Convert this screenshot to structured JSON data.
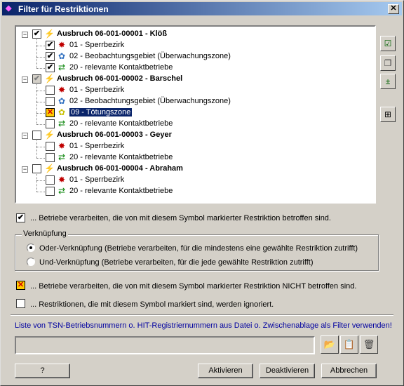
{
  "window": {
    "title": "Filter für Restriktionen",
    "close_label": "✕"
  },
  "tree": {
    "outbreaks": [
      {
        "label": "Ausbruch 06-001-00001 - Klöß",
        "checked": "✔",
        "children": [
          {
            "label": "01 - Sperrbezirk",
            "checked": "✔",
            "icon": "red-star-icon"
          },
          {
            "label": "02 - Beobachtungsgebiet (Überwachungszone)",
            "checked": "✔",
            "icon": "blue-flower-icon"
          },
          {
            "label": "20 - relevante Kontaktbetriebe",
            "checked": "✔",
            "icon": "contact-arrows-icon"
          }
        ]
      },
      {
        "label": "Ausbruch 06-001-00002 - Barschel",
        "checked": "✔",
        "children": [
          {
            "label": "01 - Sperrbezirk",
            "checked": "",
            "icon": "red-star-icon"
          },
          {
            "label": "02 - Beobachtungsgebiet (Überwachungszone)",
            "checked": "",
            "icon": "blue-flower-icon"
          },
          {
            "label": "09 - Tötungszone",
            "checked": "✕",
            "icon": "yellow-flower-icon",
            "selected": true
          },
          {
            "label": "20 - relevante Kontaktbetriebe",
            "checked": "",
            "icon": "contact-arrows-icon"
          }
        ]
      },
      {
        "label": "Ausbruch 06-001-00003 - Geyer",
        "checked": "",
        "children": [
          {
            "label": "01 - Sperrbezirk",
            "checked": "",
            "icon": "red-star-icon"
          },
          {
            "label": "20 - relevante Kontaktbetriebe",
            "checked": "",
            "icon": "contact-arrows-icon"
          }
        ]
      },
      {
        "label": "Ausbruch 06-001-00004 - Abraham",
        "checked": "",
        "children": [
          {
            "label": "01 - Sperrbezirk",
            "checked": "",
            "icon": "red-star-icon"
          },
          {
            "label": "20 - relevante Kontaktbetriebe",
            "checked": "",
            "icon": "contact-arrows-icon"
          }
        ]
      }
    ]
  },
  "legend": {
    "checked_text": "... Betriebe verarbeiten, die von mit diesem Symbol markierter Restriktion betroffen sind.",
    "checked_symbol": "✔",
    "group_title": "Verknüpfung",
    "or_option": "Oder-Verknüpfung (Betriebe verarbeiten, für die mindestens eine gewählte Restriktion zutrifft)",
    "and_option": "Und-Verknüpfung (Betriebe verarbeiten, für die jede gewählte Restriktion zutrifft)",
    "excluded_symbol": "✕",
    "excluded_text": "... Betriebe verarbeiten, die von mit diesem Symbol markierter Restriktion NICHT betroffen sind.",
    "ignored_text": "... Restriktionen, die mit diesem Symbol markiert sind, werden ignoriert."
  },
  "filter_file": {
    "link_text": "Liste von TSN-Betriebsnummern o. HIT-Registriernummern aus Datei o. Zwischenablage als Filter verwenden!",
    "value": ""
  },
  "buttons": {
    "help": "?",
    "activate": "Aktivieren",
    "deactivate": "Deaktivieren",
    "cancel": "Abbrechen"
  },
  "side_icons": [
    "check-all-icon",
    "copy-icon",
    "toggle-icon",
    "tree-icon"
  ],
  "colors": {
    "title_start": "#0a246a",
    "title_end": "#a6caf0",
    "selection": "#0a246a",
    "link": "#0000a0"
  }
}
